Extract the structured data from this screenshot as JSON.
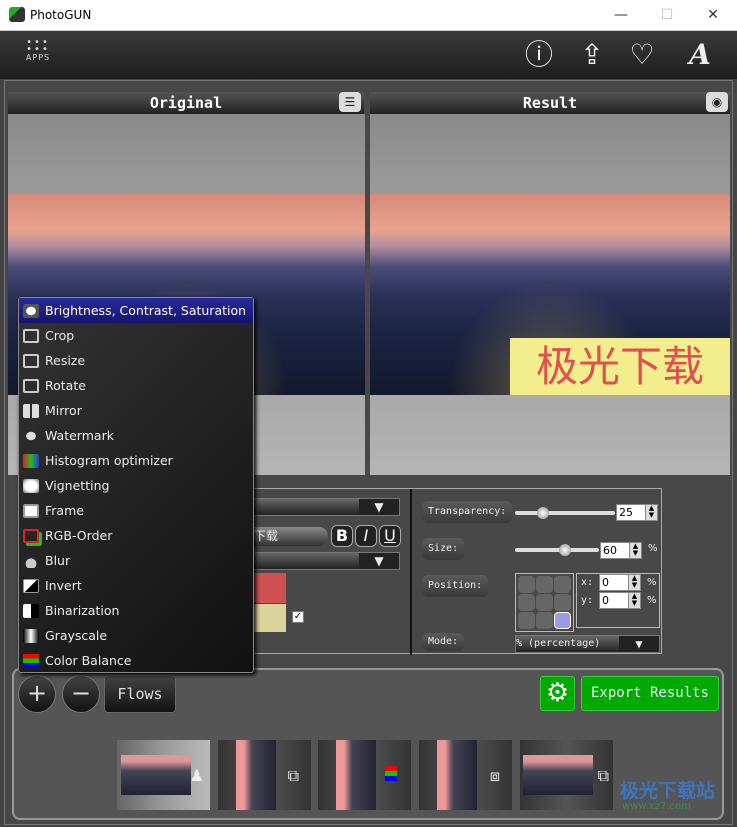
{
  "window": {
    "title": "PhotoGUN",
    "controls": [
      "—",
      "☐",
      "✕"
    ]
  },
  "toolbar": {
    "apps_label": "APPS",
    "icons": [
      "info-icon",
      "share-icon",
      "heart-icon",
      "font-icon"
    ]
  },
  "panels": {
    "original": "Original",
    "result": "Result"
  },
  "watermark_text": "极光下载",
  "menu": {
    "items": [
      "Brightness, Contrast, Saturation",
      "Crop",
      "Resize",
      "Rotate",
      "Mirror",
      "Watermark",
      "Histogram optimizer",
      "Vignetting",
      "Frame",
      "RGB-Order",
      "Blur",
      "Invert",
      "Binarization",
      "Grayscale",
      "Color Balance"
    ],
    "selected": "Brightness, Contrast, Saturation"
  },
  "watermark_options": {
    "text_value": "下载",
    "bold": "B",
    "italic": "I",
    "underline": "U",
    "text_color": "#d05050",
    "background_color": "#d8d49a",
    "background_checked": true,
    "transparency_label": "Transparency:",
    "transparency": "25",
    "size_label": "Size:",
    "size": "60",
    "size_unit": "%",
    "position_label": "Position:",
    "position_selected": "bottom-right",
    "x_label": "x:",
    "x": "0",
    "y_label": "y:",
    "y": "0",
    "unit": "%",
    "mode_label": "Mode:",
    "mode": "% (percentage)"
  },
  "bottom": {
    "add": "+",
    "remove": "−",
    "flows": "Flows",
    "export": "Export Results"
  },
  "thumbnails": [
    {
      "icon": "watermark-icon"
    },
    {
      "icon": "rotate-icon"
    },
    {
      "icon": "rgb-order-icon"
    },
    {
      "icon": "resize-icon"
    },
    {
      "icon": "rotate-icon"
    }
  ],
  "site_watermark": {
    "text": "极光下载站",
    "url": "www.xz7.com"
  }
}
